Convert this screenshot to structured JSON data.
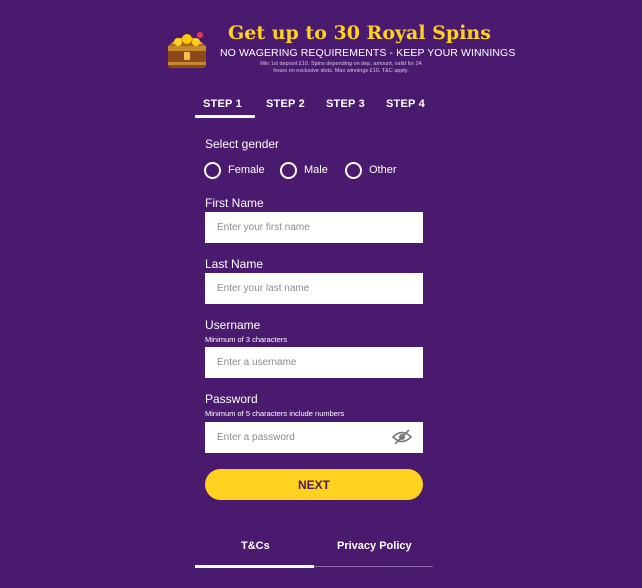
{
  "promo": {
    "title": "Get up to 30 Royal Spins",
    "subtitle": "NO WAGERING REQUIREMENTS - KEEP YOUR WINNINGS",
    "fine_print": "Min 1st deposit £10. Spins depending on dep. amount, valid for 24 hours on exclusive slots. Max winnings £10. T&C apply.",
    "icon": "treasure-chest-icon"
  },
  "steps": [
    {
      "label": "STEP 1",
      "active": true
    },
    {
      "label": "STEP 2",
      "active": false
    },
    {
      "label": "STEP 3",
      "active": false
    },
    {
      "label": "STEP 4",
      "active": false
    }
  ],
  "gender": {
    "label": "Select gender",
    "options": [
      "Female",
      "Male",
      "Other"
    ]
  },
  "first_name": {
    "label": "First Name",
    "placeholder": "Enter your first name",
    "value": ""
  },
  "last_name": {
    "label": "Last Name",
    "placeholder": "Enter your last name",
    "value": ""
  },
  "username": {
    "label": "Username",
    "hint": "Minimum of 3 characters",
    "placeholder": "Enter a username",
    "value": ""
  },
  "password": {
    "label": "Password",
    "hint": "Minimum of 5 characters include numbers",
    "placeholder": "Enter a password",
    "value": "",
    "toggle_icon": "eye-slash-icon"
  },
  "next_button": "NEXT",
  "footer_tabs": [
    {
      "label": "T&Cs",
      "active": true
    },
    {
      "label": "Privacy Policy",
      "active": false
    }
  ],
  "colors": {
    "background": "#4a1a6e",
    "accent": "#ffd21f",
    "text": "#ffffff"
  }
}
